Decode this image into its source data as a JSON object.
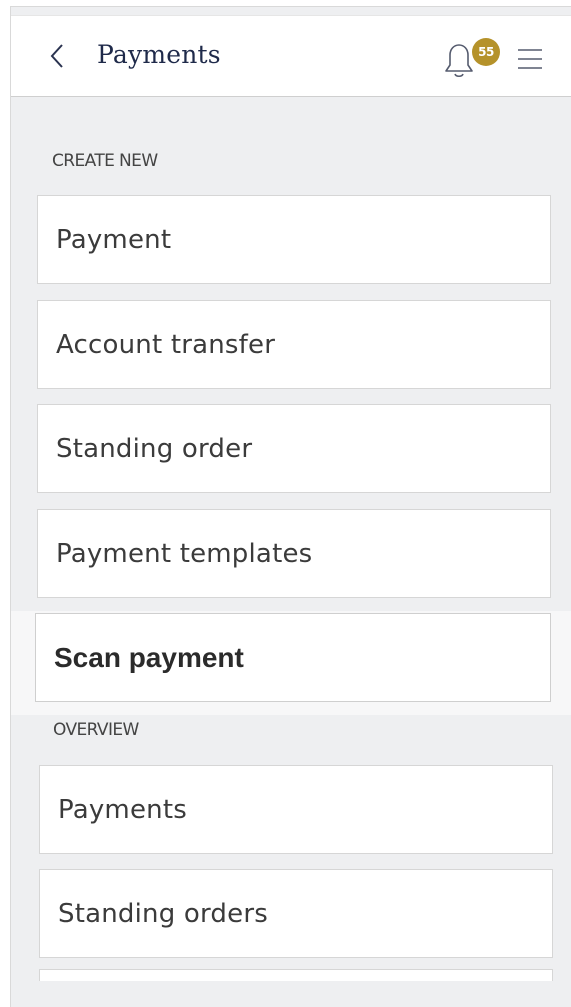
{
  "header": {
    "title": "Payments",
    "notification_count": "55"
  },
  "sections": {
    "create_new_label": "CREATE NEW",
    "overview_label": "OVERVIEW"
  },
  "create_items": [
    {
      "label": "Payment"
    },
    {
      "label": "Account transfer"
    },
    {
      "label": "Standing order"
    },
    {
      "label": "Payment templates"
    },
    {
      "label": "Scan payment"
    }
  ],
  "overview_items": [
    {
      "label": "Payments"
    },
    {
      "label": "Standing orders"
    }
  ],
  "colors": {
    "title": "#1f2a4a",
    "badge": "#b5922a",
    "background": "#eeeff1"
  }
}
